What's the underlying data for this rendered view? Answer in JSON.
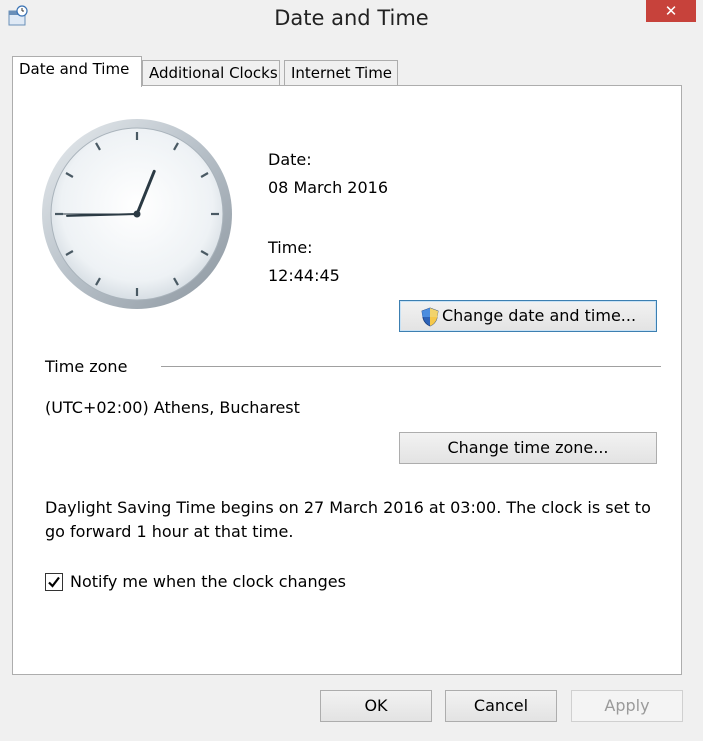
{
  "window": {
    "title": "Date and Time",
    "close_label": "✕"
  },
  "tabs": [
    {
      "label": "Date and Time",
      "active": true
    },
    {
      "label": "Additional Clocks",
      "active": false
    },
    {
      "label": "Internet Time",
      "active": false
    }
  ],
  "clock": {
    "hour": 12,
    "minute": 44,
    "second": 45
  },
  "date_section": {
    "date_label": "Date:",
    "date_value": "08 March 2016",
    "time_label": "Time:",
    "time_value": "12:44:45",
    "change_button": "Change date and time..."
  },
  "timezone_section": {
    "heading": "Time zone",
    "value": "(UTC+02:00) Athens, Bucharest",
    "change_button": "Change time zone..."
  },
  "dst": {
    "line1": "Daylight Saving Time begins on 27 March 2016 at 03:00. The clock is set to",
    "line2": "go forward 1 hour at that time."
  },
  "notify": {
    "label": "Notify me when the clock changes",
    "checked": true
  },
  "footer": {
    "ok": "OK",
    "cancel": "Cancel",
    "apply": "Apply"
  },
  "colors": {
    "close_button": "#c7423b",
    "focus_border": "#3c7fb1"
  }
}
